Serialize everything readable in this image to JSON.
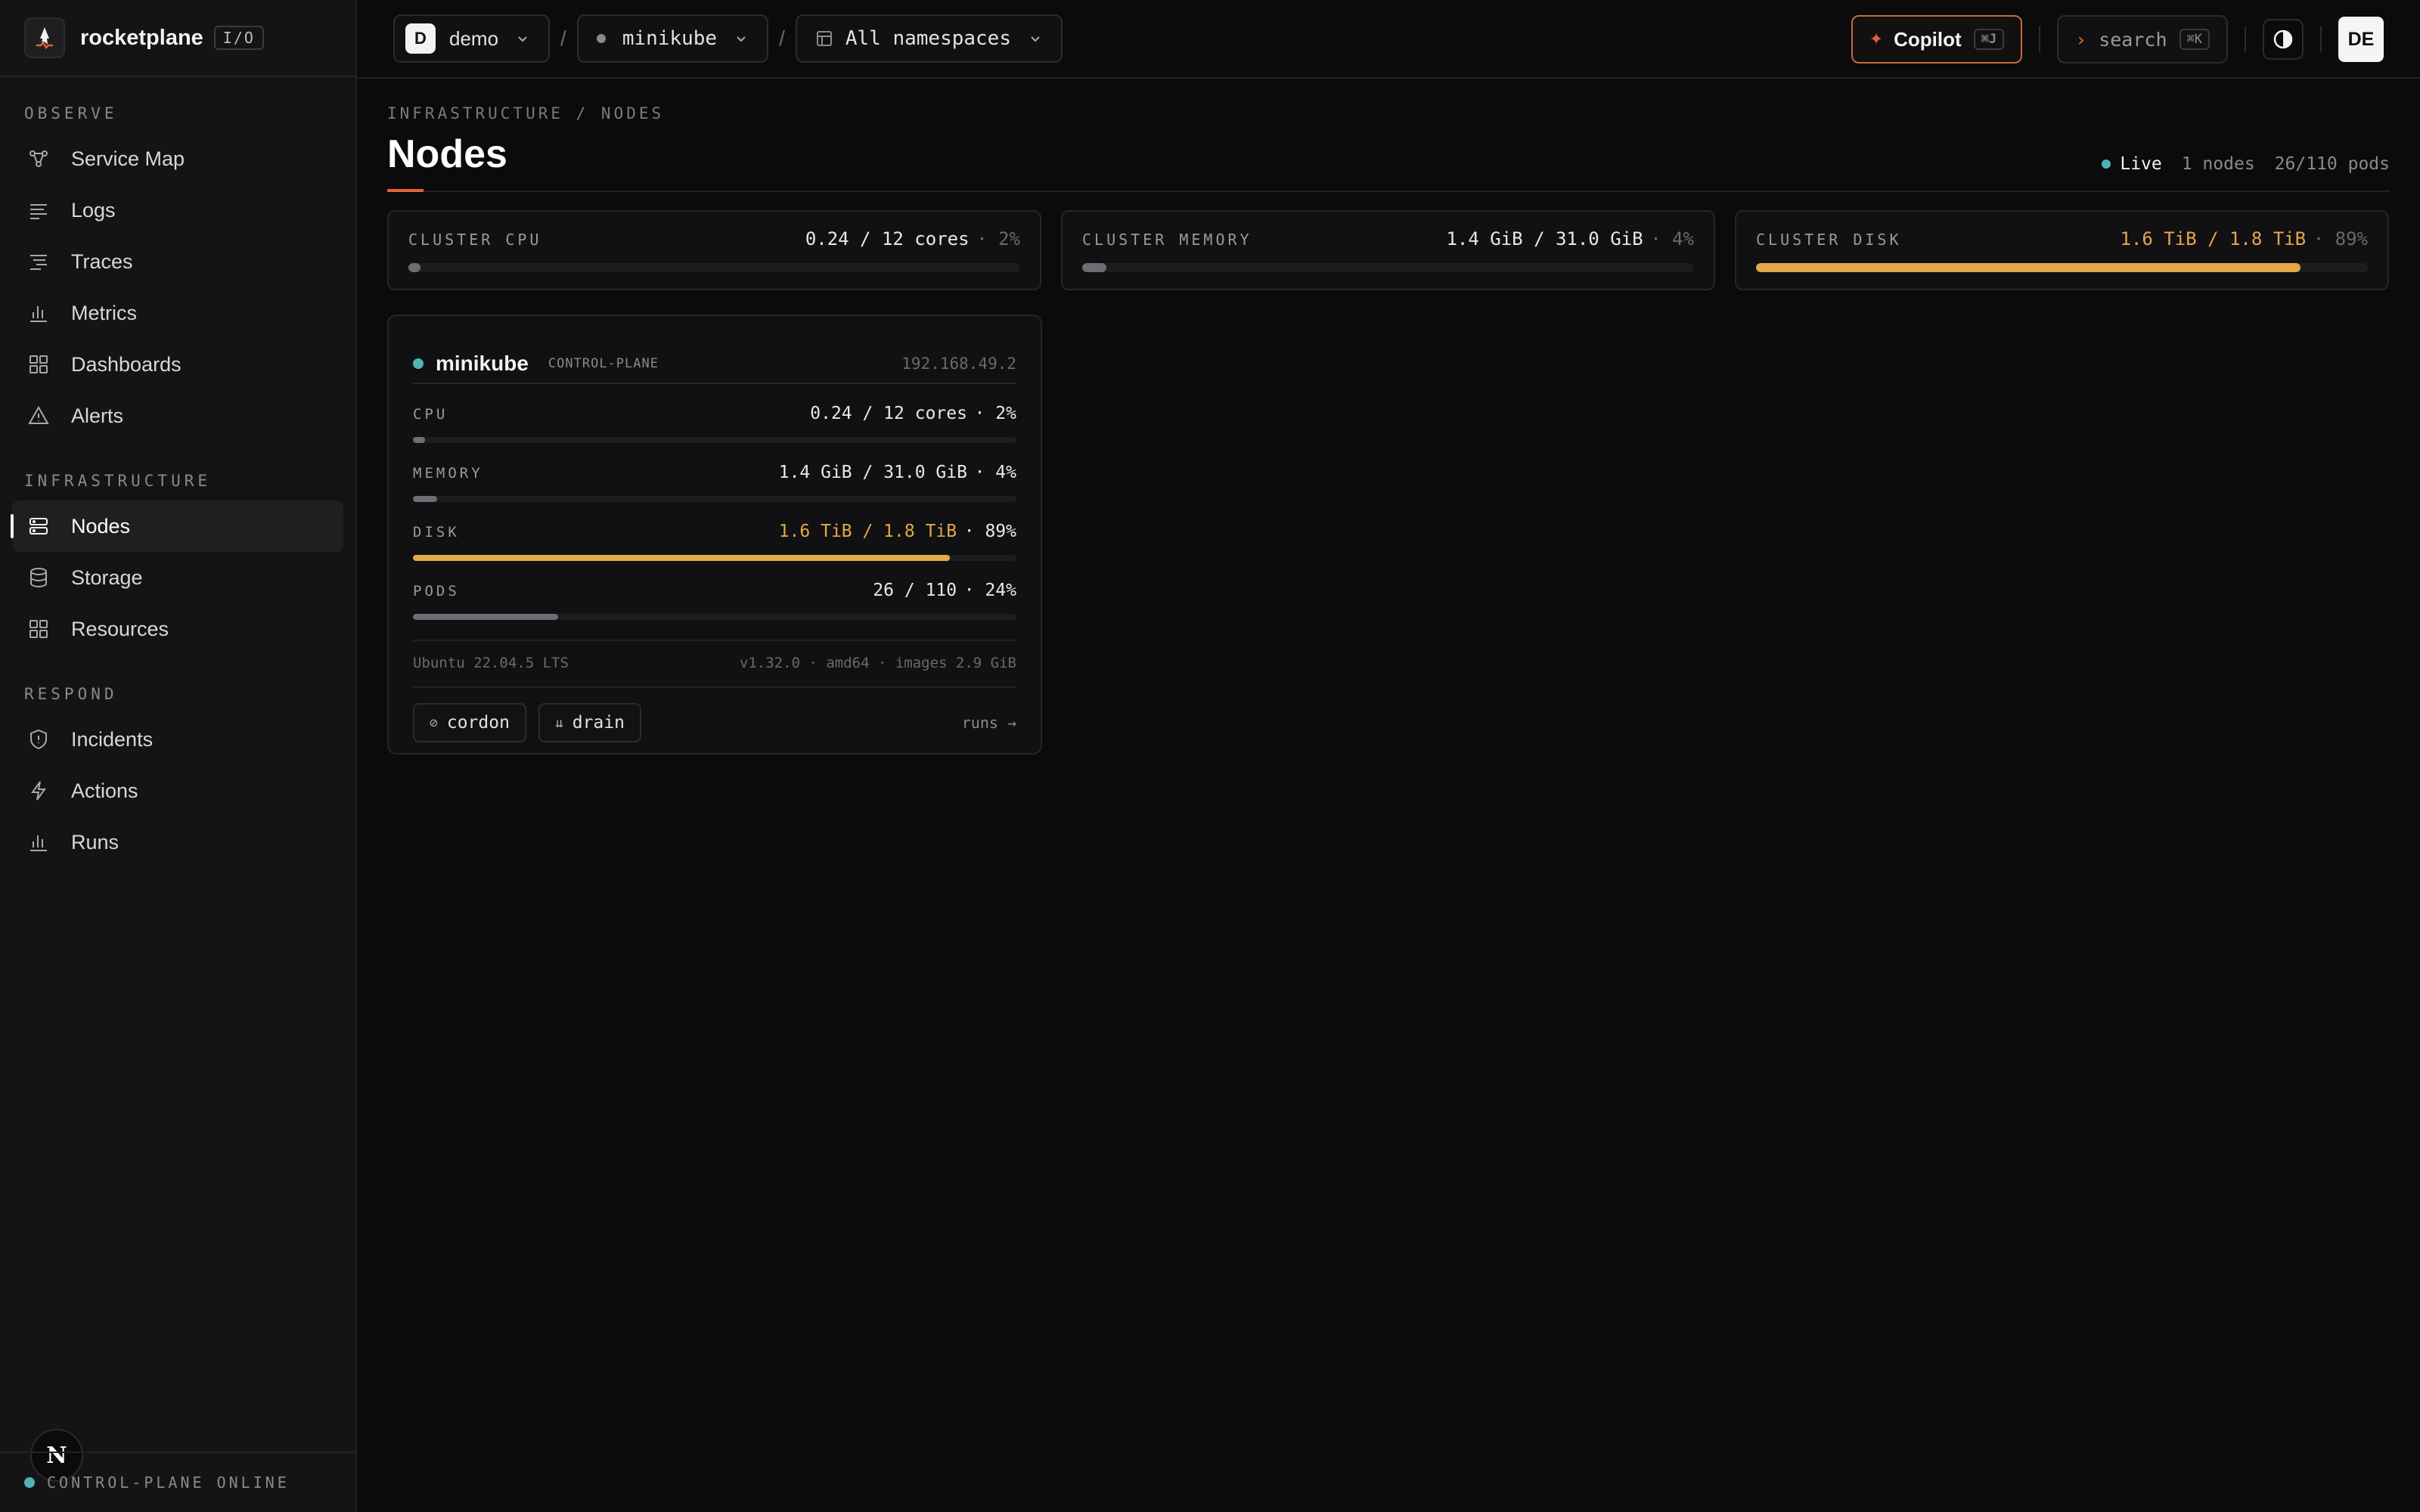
{
  "brand": {
    "name": "rocketplane",
    "tag": "I/O"
  },
  "sidebar": {
    "sections": [
      {
        "title": "OBSERVE",
        "items": [
          {
            "label": "Service Map",
            "icon": "service-map-icon"
          },
          {
            "label": "Logs",
            "icon": "logs-icon"
          },
          {
            "label": "Traces",
            "icon": "traces-icon"
          },
          {
            "label": "Metrics",
            "icon": "metrics-icon"
          },
          {
            "label": "Dashboards",
            "icon": "dashboards-icon"
          },
          {
            "label": "Alerts",
            "icon": "alert-icon"
          }
        ]
      },
      {
        "title": "INFRASTRUCTURE",
        "items": [
          {
            "label": "Nodes",
            "icon": "nodes-icon",
            "active": true
          },
          {
            "label": "Storage",
            "icon": "storage-icon"
          },
          {
            "label": "Resources",
            "icon": "resources-icon"
          }
        ]
      },
      {
        "title": "RESPOND",
        "items": [
          {
            "label": "Incidents",
            "icon": "shield-icon"
          },
          {
            "label": "Actions",
            "icon": "bolt-icon"
          },
          {
            "label": "Runs",
            "icon": "runs-icon"
          }
        ]
      }
    ],
    "footer": "CONTROL-PLANE ONLINE"
  },
  "topbar": {
    "org": {
      "initial": "D",
      "label": "demo"
    },
    "cluster": "minikube",
    "namespace": "All namespaces",
    "copilot": {
      "label": "Copilot",
      "shortcut": "⌘J"
    },
    "search": {
      "label": "search",
      "shortcut": "⌘K"
    },
    "avatar": "DE"
  },
  "page": {
    "breadcrumb": "INFRASTRUCTURE / NODES",
    "title": "Nodes",
    "live": "Live",
    "node_count": "1 nodes",
    "pod_count": "26/110 pods"
  },
  "cluster": [
    {
      "label": "CLUSTER CPU",
      "value": "0.24 / 12 cores",
      "pct": "· 2%",
      "fraction": 0.02,
      "warn": false
    },
    {
      "label": "CLUSTER MEMORY",
      "value": "1.4 GiB / 31.0 GiB",
      "pct": "· 4%",
      "fraction": 0.04,
      "warn": false
    },
    {
      "label": "CLUSTER DISK",
      "value": "1.6 TiB / 1.8 TiB",
      "pct": "· 89%",
      "fraction": 0.89,
      "warn": true
    }
  ],
  "node": {
    "name": "minikube",
    "role": "CONTROL-PLANE",
    "ip": "192.168.49.2",
    "metrics": [
      {
        "label": "CPU",
        "value": "0.24 / 12 cores",
        "pct": "· 2%",
        "fraction": 0.02,
        "warn": false
      },
      {
        "label": "MEMORY",
        "value": "1.4 GiB / 31.0 GiB",
        "pct": "· 4%",
        "fraction": 0.04,
        "warn": false
      },
      {
        "label": "DISK",
        "value": "1.6 TiB / 1.8 TiB",
        "pct": "· 89%",
        "fraction": 0.89,
        "warn": true
      },
      {
        "label": "PODS",
        "value": "26 / 110",
        "pct": "· 24%",
        "fraction": 0.24,
        "warn": false
      }
    ],
    "os": "Ubuntu 22.04.5 LTS",
    "details": "v1.32.0 · amd64 · images 2.9 GiB",
    "actions": {
      "cordon": "cordon",
      "drain": "drain",
      "runs": "runs →"
    }
  },
  "colors": {
    "accent": "#e0643a",
    "warn": "#e2a84a",
    "live": "#4fb3b3"
  }
}
